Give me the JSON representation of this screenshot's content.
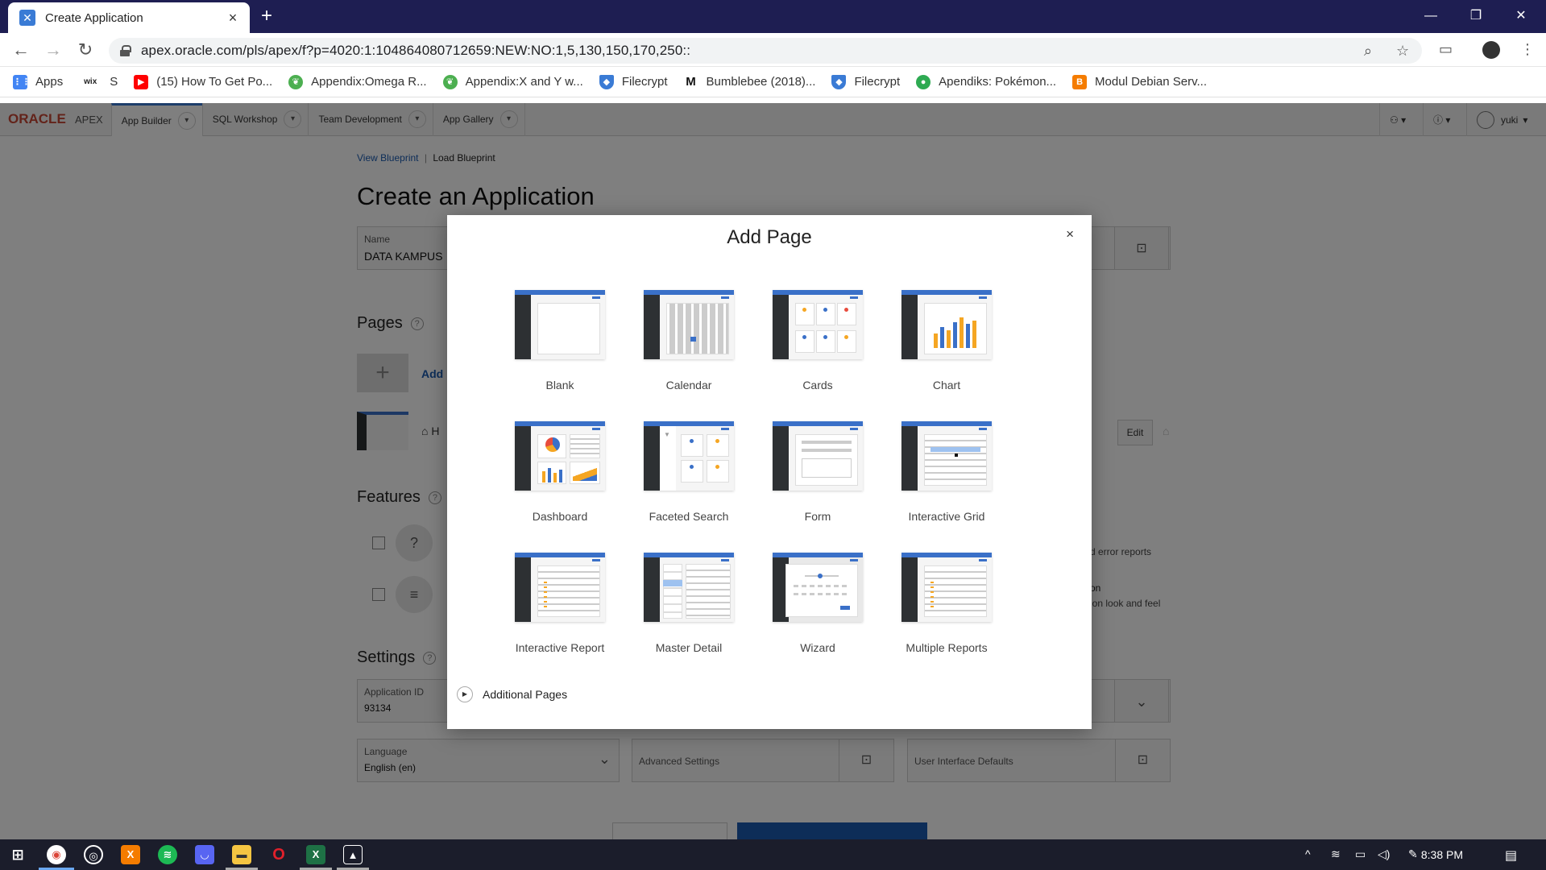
{
  "browser": {
    "tab_title": "Create Application",
    "tab_close": "×",
    "new_tab": "+",
    "url": "apex.oracle.com/pls/apex/f?p=4020:1:104864080712659:NEW:NO:1,5,130,150,170,250::",
    "bookmarks": [
      {
        "label": "Apps",
        "icon": "apps-grid-icon",
        "color": "#4285f4"
      },
      {
        "label": "S",
        "icon": "wix-icon",
        "color": "#222222"
      },
      {
        "label": "(15) How To Get Po...",
        "icon": "youtube-icon",
        "color": "#ff0000"
      },
      {
        "label": "Appendix:Omega R...",
        "icon": "leaf-icon",
        "color": "#4caf50"
      },
      {
        "label": "Appendix:X and Y w...",
        "icon": "leaf-icon",
        "color": "#4caf50"
      },
      {
        "label": "Filecrypt",
        "icon": "shield-icon",
        "color": "#3a7bd5"
      },
      {
        "label": "Bumblebee (2018)...",
        "icon": "m-logo-icon",
        "color": "#111111"
      },
      {
        "label": "Filecrypt",
        "icon": "shield-icon",
        "color": "#3a7bd5"
      },
      {
        "label": "Apendiks: Pokémon...",
        "icon": "pokeball-icon",
        "color": "#2eaa52"
      },
      {
        "label": "Modul Debian Serv...",
        "icon": "blogger-icon",
        "color": "#f57c00"
      }
    ]
  },
  "apex": {
    "logo": "ORACLE",
    "logo_suffix": "APEX",
    "nav": [
      "App Builder",
      "SQL Workshop",
      "Team Development",
      "App Gallery"
    ],
    "user": "yuki",
    "breadcrumbs": [
      "View Blueprint",
      "Load Blueprint"
    ],
    "page_title": "Create an Application",
    "name_label": "Name",
    "name_value": "DATA KAMPUS",
    "pages_title": "Pages",
    "add_label": "Add",
    "home_initial": "H",
    "edit_label": "Edit",
    "features_title": "Features",
    "feature_hint_1": "d error reports",
    "feature_hint_2a": "on",
    "feature_hint_2b": "ion look and feel",
    "settings_title": "Settings",
    "app_id_label": "Application ID",
    "app_id_value": "93134",
    "language_label": "Language",
    "language_value": "English (en)",
    "advanced_label": "Advanced Settings",
    "ui_defaults_label": "User Interface Defaults"
  },
  "dialog": {
    "title": "Add Page",
    "close": "×",
    "tiles": [
      {
        "label": "Blank"
      },
      {
        "label": "Calendar"
      },
      {
        "label": "Cards"
      },
      {
        "label": "Chart"
      },
      {
        "label": "Dashboard"
      },
      {
        "label": "Faceted Search"
      },
      {
        "label": "Form"
      },
      {
        "label": "Interactive Grid"
      },
      {
        "label": "Interactive Report"
      },
      {
        "label": "Master Detail"
      },
      {
        "label": "Wizard"
      },
      {
        "label": "Multiple Reports"
      }
    ],
    "additional": "Additional Pages"
  },
  "taskbar": {
    "clock": "8:38 PM"
  }
}
